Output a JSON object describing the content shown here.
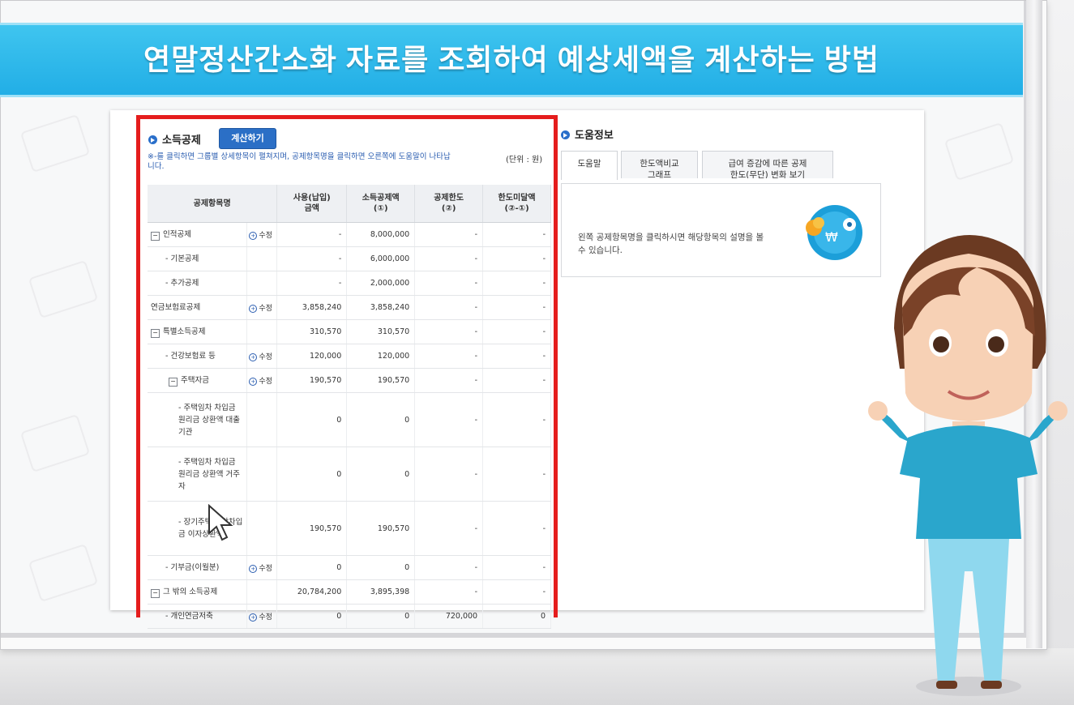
{
  "banner": {
    "title": "연말정산간소화 자료를 조회하여 예상세액을 계산하는 방법"
  },
  "income_deduction": {
    "title": "소득공제",
    "calc_button": "계산하기",
    "note": "※-를 클릭하면 그룹별 상세항목이 펼쳐지며, 공제항목명을 클릭하면 오른쪽에 도움말이 나타납니다.",
    "unit": "(단위 : 원)",
    "headers": [
      "공제항목명",
      "사용(납입)\n금액",
      "소득공제액\n(①)",
      "공제한도\n(②)",
      "한도미달액\n(②-①)"
    ],
    "edit_label": "수정",
    "rows": [
      {
        "name": "인적공제",
        "marker": "minus",
        "indent": 0,
        "edit": true,
        "amount": "-",
        "deduction": "8,000,000",
        "limit": "-",
        "shortfall": "-"
      },
      {
        "name": "- 기본공제",
        "marker": "",
        "indent": 1,
        "edit": false,
        "amount": "-",
        "deduction": "6,000,000",
        "limit": "-",
        "shortfall": "-"
      },
      {
        "name": "- 추가공제",
        "marker": "",
        "indent": 1,
        "edit": false,
        "amount": "-",
        "deduction": "2,000,000",
        "limit": "-",
        "shortfall": "-"
      },
      {
        "name": "연금보험료공제",
        "marker": "",
        "indent": 0,
        "edit": true,
        "amount": "3,858,240",
        "deduction": "3,858,240",
        "limit": "-",
        "shortfall": "-"
      },
      {
        "name": "특별소득공제",
        "marker": "minus",
        "indent": 0,
        "edit": false,
        "amount": "310,570",
        "deduction": "310,570",
        "limit": "-",
        "shortfall": "-"
      },
      {
        "name": "- 건강보험료 등",
        "marker": "",
        "indent": 1,
        "edit": true,
        "amount": "120,000",
        "deduction": "120,000",
        "limit": "-",
        "shortfall": "-"
      },
      {
        "name": "주택자금",
        "marker": "minus",
        "indent": 2,
        "edit": true,
        "amount": "190,570",
        "deduction": "190,570",
        "limit": "-",
        "shortfall": "-"
      },
      {
        "name": "- 주택임차 차입금 원리금 상환액 대출기관",
        "marker": "",
        "indent": 3,
        "edit": false,
        "amount": "0",
        "deduction": "0",
        "limit": "-",
        "shortfall": "-"
      },
      {
        "name": "- 주택임차 차입금 원리금 상환액 거주자",
        "marker": "",
        "indent": 3,
        "edit": false,
        "amount": "0",
        "deduction": "0",
        "limit": "-",
        "shortfall": "-"
      },
      {
        "name": "- 장기주택 저당차입금 이자상환액",
        "marker": "",
        "indent": 3,
        "edit": false,
        "amount": "190,570",
        "deduction": "190,570",
        "limit": "-",
        "shortfall": "-"
      },
      {
        "name": "- 기부금(이월분)",
        "marker": "",
        "indent": 1,
        "edit": true,
        "amount": "0",
        "deduction": "0",
        "limit": "-",
        "shortfall": "-"
      },
      {
        "name": "그 밖의 소득공제",
        "marker": "minus",
        "indent": 0,
        "edit": false,
        "amount": "20,784,200",
        "deduction": "3,895,398",
        "limit": "-",
        "shortfall": "-"
      },
      {
        "name": "- 개인연금저축",
        "marker": "",
        "indent": 1,
        "edit": true,
        "amount": "0",
        "deduction": "0",
        "limit": "720,000",
        "shortfall": "0"
      }
    ]
  },
  "help": {
    "title": "도움정보",
    "tabs": [
      "도움말",
      "한도액비교\n그래프",
      "급여 증감에 따른 공제\n한도(무단) 변화 보기"
    ],
    "text": "왼쪽 공제항목명을 클릭하시면 해당항목의 설명을 볼 수 있습니다."
  },
  "colors": {
    "banner": "#22aee6",
    "highlight": "#e51d1d",
    "accent": "#2b6fc6"
  }
}
